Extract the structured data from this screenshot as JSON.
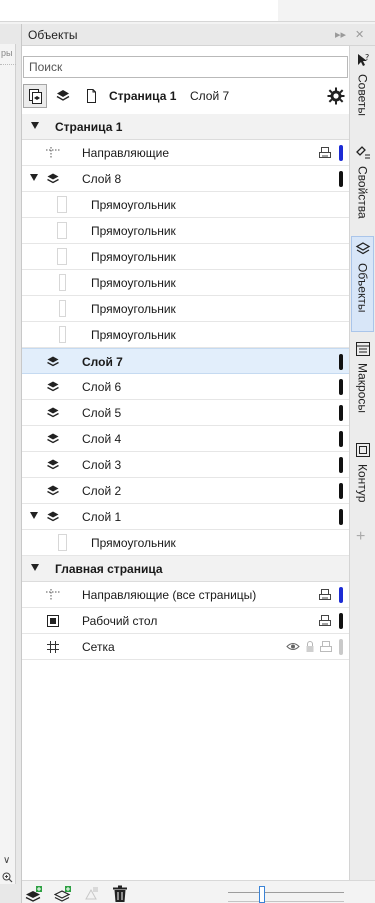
{
  "left_strip": {
    "ruler_text": "ры"
  },
  "docker": {
    "title": "Объекты",
    "search_placeholder": "Поиск",
    "toolbar": {
      "current_page": "Страница 1",
      "current_layer": "Слой 7"
    }
  },
  "tree": {
    "page1": {
      "label": "Страница 1",
      "guides": "Направляющие",
      "layer8": "Слой 8",
      "layer8_children": [
        "Прямоугольник",
        "Прямоугольник",
        "Прямоугольник",
        "Прямоугольник",
        "Прямоугольник",
        "Прямоугольник"
      ],
      "layer7": "Слой 7",
      "layer6": "Слой 6",
      "layer5": "Слой 5",
      "layer4": "Слой 4",
      "layer3": "Слой 3",
      "layer2": "Слой 2",
      "layer1": "Слой 1",
      "layer1_child": "Прямоугольник"
    },
    "master": {
      "label": "Главная страница",
      "guides": "Направляющие (все страницы)",
      "desktop": "Рабочий стол",
      "grid": "Сетка"
    }
  },
  "tabs": [
    "Советы",
    "Свойства",
    "Объекты",
    "Макросы",
    "Контур"
  ],
  "colors": {
    "accent": "#1c2bd4",
    "selected_bg": "#e2eefb",
    "slider_thumb": "#3a83d6"
  }
}
